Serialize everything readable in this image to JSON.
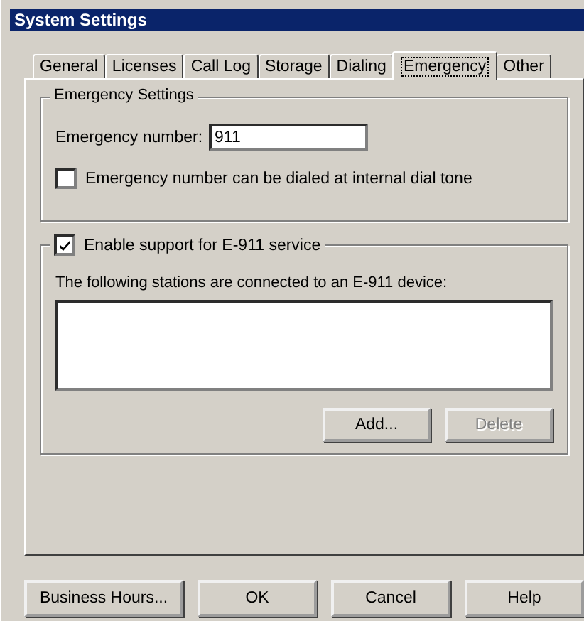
{
  "window": {
    "title": "System Settings"
  },
  "tabs": [
    {
      "label": "General",
      "selected": false
    },
    {
      "label": "Licenses",
      "selected": false
    },
    {
      "label": "Call Log",
      "selected": false
    },
    {
      "label": "Storage",
      "selected": false
    },
    {
      "label": "Dialing",
      "selected": false
    },
    {
      "label": "Emergency",
      "selected": true
    },
    {
      "label": "Other",
      "selected": false
    }
  ],
  "emergency_settings": {
    "title": "Emergency Settings",
    "number_label": "Emergency number:",
    "number_value": "911",
    "dial_tone_checkbox": {
      "label": "Emergency number can be dialed at internal dial tone",
      "checked": false
    }
  },
  "e911": {
    "checkbox": {
      "label": "Enable support for E-911 service",
      "checked": true
    },
    "description": "The following stations are connected to an E-911 device:",
    "buttons": [
      {
        "label": "Add...",
        "disabled": false
      },
      {
        "label": "Delete",
        "disabled": true
      }
    ]
  },
  "footer_buttons": [
    "Business Hours...",
    "OK",
    "Cancel",
    "Help"
  ]
}
